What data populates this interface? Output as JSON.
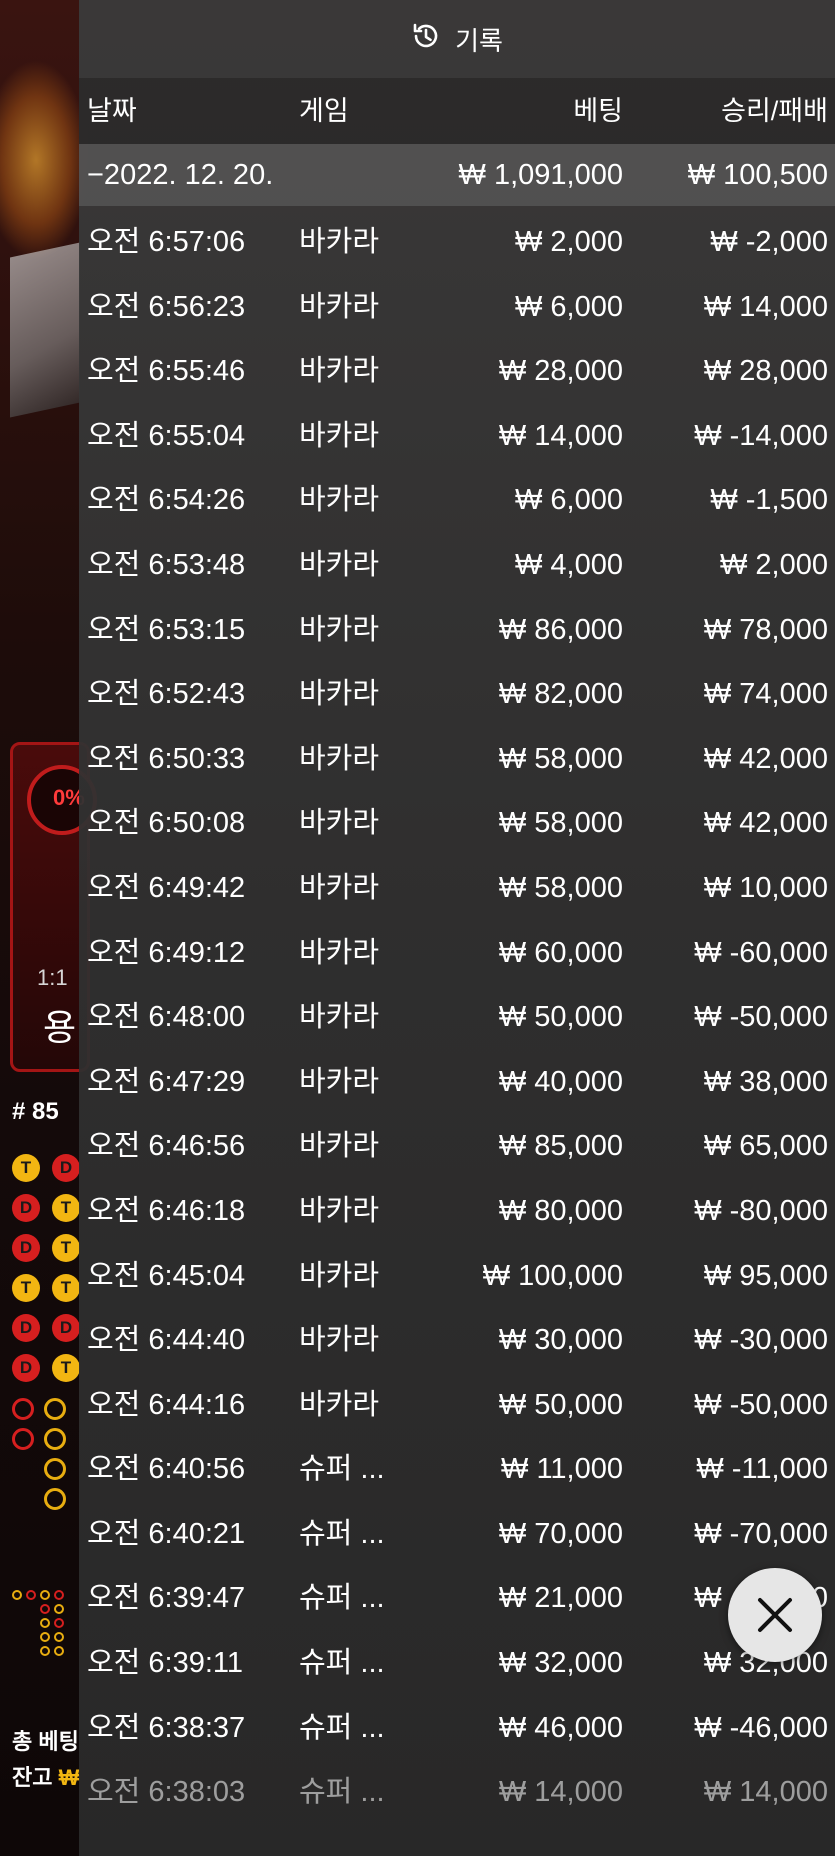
{
  "panel": {
    "title": "기록",
    "columns": {
      "date": "날짜",
      "game": "게임",
      "bet": "베팅",
      "winloss": "승리/패배"
    },
    "summary": {
      "date": "−2022. 12. 20.",
      "bet": "₩ 1,091,000",
      "winloss": "₩ 100,500"
    },
    "rows": [
      {
        "time": "오전 6:57:06",
        "game": "바카라",
        "bet": "₩ 2,000",
        "winloss": "₩ -2,000"
      },
      {
        "time": "오전 6:56:23",
        "game": "바카라",
        "bet": "₩ 6,000",
        "winloss": "₩ 14,000"
      },
      {
        "time": "오전 6:55:46",
        "game": "바카라",
        "bet": "₩ 28,000",
        "winloss": "₩ 28,000"
      },
      {
        "time": "오전 6:55:04",
        "game": "바카라",
        "bet": "₩ 14,000",
        "winloss": "₩ -14,000"
      },
      {
        "time": "오전 6:54:26",
        "game": "바카라",
        "bet": "₩ 6,000",
        "winloss": "₩ -1,500"
      },
      {
        "time": "오전 6:53:48",
        "game": "바카라",
        "bet": "₩ 4,000",
        "winloss": "₩ 2,000"
      },
      {
        "time": "오전 6:53:15",
        "game": "바카라",
        "bet": "₩ 86,000",
        "winloss": "₩ 78,000"
      },
      {
        "time": "오전 6:52:43",
        "game": "바카라",
        "bet": "₩ 82,000",
        "winloss": "₩ 74,000"
      },
      {
        "time": "오전 6:50:33",
        "game": "바카라",
        "bet": "₩ 58,000",
        "winloss": "₩ 42,000"
      },
      {
        "time": "오전 6:50:08",
        "game": "바카라",
        "bet": "₩ 58,000",
        "winloss": "₩ 42,000"
      },
      {
        "time": "오전 6:49:42",
        "game": "바카라",
        "bet": "₩ 58,000",
        "winloss": "₩ 10,000"
      },
      {
        "time": "오전 6:49:12",
        "game": "바카라",
        "bet": "₩ 60,000",
        "winloss": "₩ -60,000"
      },
      {
        "time": "오전 6:48:00",
        "game": "바카라",
        "bet": "₩ 50,000",
        "winloss": "₩ -50,000"
      },
      {
        "time": "오전 6:47:29",
        "game": "바카라",
        "bet": "₩ 40,000",
        "winloss": "₩ 38,000"
      },
      {
        "time": "오전 6:46:56",
        "game": "바카라",
        "bet": "₩ 85,000",
        "winloss": "₩ 65,000"
      },
      {
        "time": "오전 6:46:18",
        "game": "바카라",
        "bet": "₩ 80,000",
        "winloss": "₩ -80,000"
      },
      {
        "time": "오전 6:45:04",
        "game": "바카라",
        "bet": "₩ 100,000",
        "winloss": "₩ 95,000"
      },
      {
        "time": "오전 6:44:40",
        "game": "바카라",
        "bet": "₩ 30,000",
        "winloss": "₩ -30,000"
      },
      {
        "time": "오전 6:44:16",
        "game": "바카라",
        "bet": "₩ 50,000",
        "winloss": "₩ -50,000"
      },
      {
        "time": "오전 6:40:56",
        "game": "슈퍼 ...",
        "bet": "₩ 11,000",
        "winloss": "₩ -11,000"
      },
      {
        "time": "오전 6:40:21",
        "game": "슈퍼 ...",
        "bet": "₩ 70,000",
        "winloss": "₩ -70,000"
      },
      {
        "time": "오전 6:39:47",
        "game": "슈퍼 ...",
        "bet": "₩ 21,000",
        "winloss": "₩ -19,000"
      },
      {
        "time": "오전 6:39:11",
        "game": "슈퍼 ...",
        "bet": "₩ 32,000",
        "winloss": "₩ 32,000"
      },
      {
        "time": "오전 6:38:37",
        "game": "슈퍼 ...",
        "bet": "₩ 46,000",
        "winloss": "₩ -46,000"
      },
      {
        "time": "오전 6:38:03",
        "game": "슈퍼 ...",
        "bet": "₩ 14,000",
        "winloss": "₩ 14,000"
      }
    ]
  },
  "background": {
    "bet_box": {
      "percent": "0%",
      "odds": "1:1",
      "name": "용"
    },
    "round": "# 85",
    "footer": {
      "total_bet_label": "총 베팅",
      "balance_label": "잔고",
      "balance_value": "₩"
    }
  },
  "icons": {
    "header": "history-icon",
    "close": "close-icon"
  },
  "colors": {
    "panel_bg": "#333333",
    "tie_bead": "#f2b612",
    "dragon_bead": "#d61f1f"
  }
}
